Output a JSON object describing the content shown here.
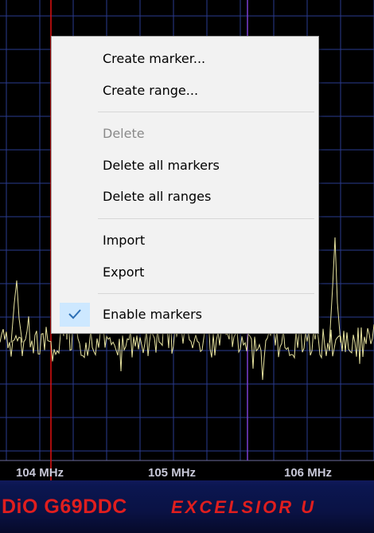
{
  "context_menu": {
    "items": [
      {
        "label": "Create marker...",
        "enabled": true
      },
      {
        "label": "Create range...",
        "enabled": true
      },
      {
        "label": "Delete",
        "enabled": false
      },
      {
        "label": "Delete all markers",
        "enabled": true
      },
      {
        "label": "Delete all ranges",
        "enabled": true
      },
      {
        "label": "Import",
        "enabled": true
      },
      {
        "label": "Export",
        "enabled": true
      },
      {
        "label": "Enable markers",
        "enabled": true,
        "checked": true
      }
    ]
  },
  "spectrum": {
    "freq_labels": [
      "104 MHz",
      "105 MHz",
      "106 MHz"
    ],
    "grid_color": "#2a3b8f",
    "trace_color": "#e8e4a0",
    "marker_color": "#e01010",
    "range_color": "#7b3fd0"
  },
  "brand": {
    "model": "DiO G69DDC",
    "edition": "EXCELSIOR U"
  },
  "icons": {
    "check": "check-icon"
  }
}
